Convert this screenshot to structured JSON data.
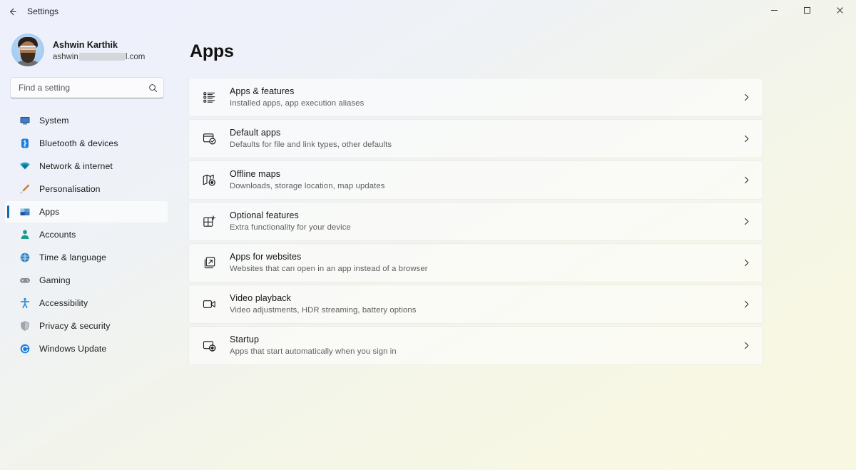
{
  "titlebar": {
    "back_icon": "back-arrow-icon",
    "title": "Settings",
    "minimize_label": "Minimise",
    "maximize_label": "Maximise",
    "close_label": "Close"
  },
  "sidebar": {
    "profile": {
      "name": "Ashwin Karthik",
      "email_prefix": "ashwin",
      "email_suffix": "l.com",
      "avatar_icon": "user-avatar"
    },
    "search": {
      "placeholder": "Find a setting",
      "value": "",
      "icon": "search-icon"
    },
    "items": [
      {
        "label": "System",
        "icon": "monitor-icon",
        "color": "#1a4e8a",
        "active": false
      },
      {
        "label": "Bluetooth & devices",
        "icon": "bluetooth-icon",
        "color": "#1b7fe0",
        "active": false
      },
      {
        "label": "Network & internet",
        "icon": "wifi-icon",
        "color": "#1aa7a7",
        "active": false
      },
      {
        "label": "Personalisation",
        "icon": "paintbrush-icon",
        "color": "#d98a2b",
        "active": false
      },
      {
        "label": "Apps",
        "icon": "apps-grid-icon",
        "color": "#2f6fb5",
        "active": true
      },
      {
        "label": "Accounts",
        "icon": "person-icon",
        "color": "#1fa38a",
        "active": false
      },
      {
        "label": "Time & language",
        "icon": "globe-clock-icon",
        "color": "#2a7fc0",
        "active": false
      },
      {
        "label": "Gaming",
        "icon": "gamepad-icon",
        "color": "#8a8a94",
        "active": false
      },
      {
        "label": "Accessibility",
        "icon": "accessibility-icon",
        "color": "#2a8fe0",
        "active": false
      },
      {
        "label": "Privacy & security",
        "icon": "shield-icon",
        "color": "#9a9aa6",
        "active": false
      },
      {
        "label": "Windows Update",
        "icon": "update-icon",
        "color": "#1b7fe0",
        "active": false
      }
    ]
  },
  "main": {
    "title": "Apps",
    "cards": [
      {
        "title": "Apps & features",
        "subtitle": "Installed apps, app execution aliases",
        "icon": "apps-list-icon",
        "chevron": "chevron-right-icon"
      },
      {
        "title": "Default apps",
        "subtitle": "Defaults for file and link types, other defaults",
        "icon": "default-apps-icon",
        "chevron": "chevron-right-icon"
      },
      {
        "title": "Offline maps",
        "subtitle": "Downloads, storage location, map updates",
        "icon": "offline-maps-icon",
        "chevron": "chevron-right-icon"
      },
      {
        "title": "Optional features",
        "subtitle": "Extra functionality for your device",
        "icon": "optional-features-icon",
        "chevron": "chevron-right-icon"
      },
      {
        "title": "Apps for websites",
        "subtitle": "Websites that can open in an app instead of a browser",
        "icon": "apps-for-websites-icon",
        "chevron": "chevron-right-icon"
      },
      {
        "title": "Video playback",
        "subtitle": "Video adjustments, HDR streaming, battery options",
        "icon": "video-playback-icon",
        "chevron": "chevron-right-icon"
      },
      {
        "title": "Startup",
        "subtitle": "Apps that start automatically when you sign in",
        "icon": "startup-icon",
        "chevron": "chevron-right-icon"
      }
    ]
  },
  "colors": {
    "accent": "#0f6cbd",
    "bg_top": "#eef1fc",
    "bg_bottom": "#f8f8e2"
  }
}
